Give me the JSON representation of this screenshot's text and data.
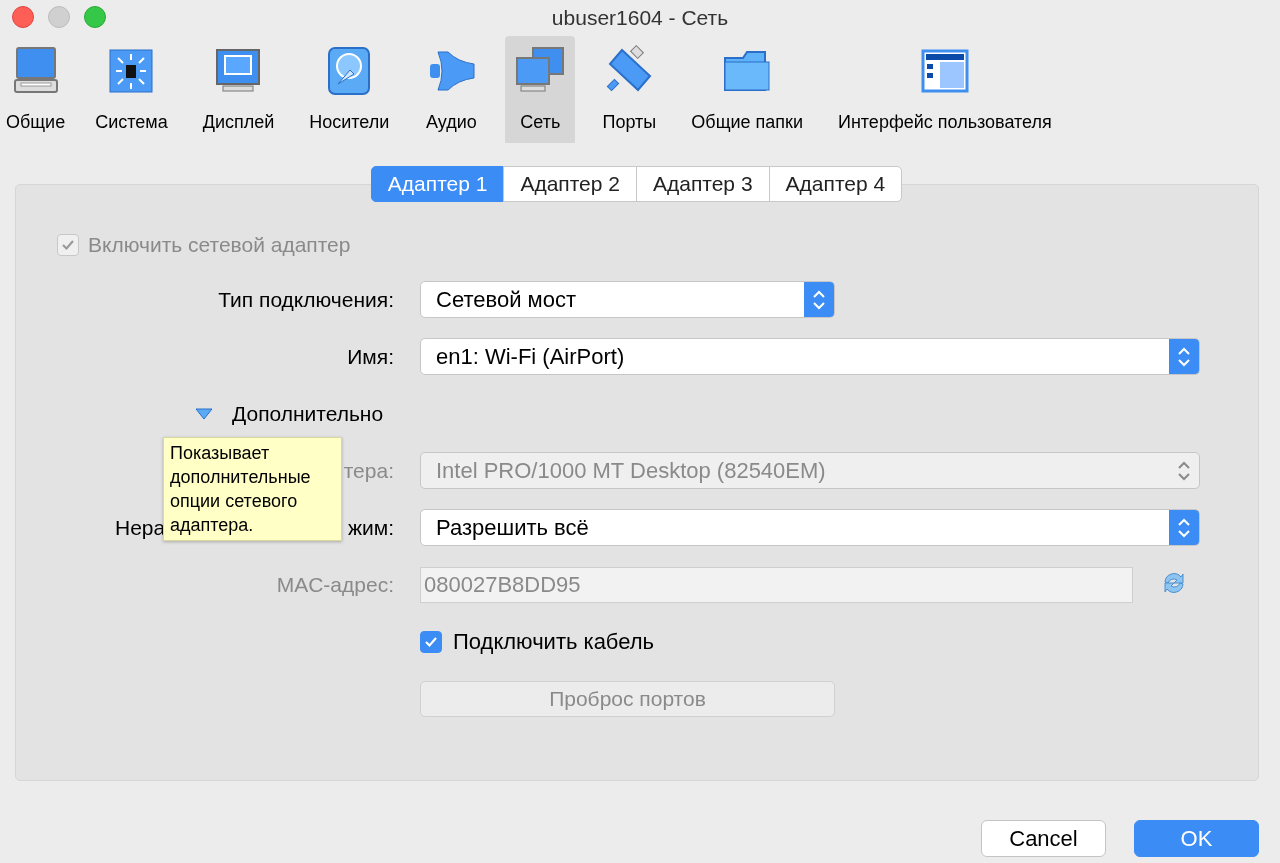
{
  "window": {
    "title": "ubuser1604 - Сеть"
  },
  "toolbar": [
    {
      "label": "Общие",
      "kind": "general",
      "selected": false
    },
    {
      "label": "Система",
      "kind": "system",
      "selected": false
    },
    {
      "label": "Дисплей",
      "kind": "display",
      "selected": false
    },
    {
      "label": "Носители",
      "kind": "storage",
      "selected": false
    },
    {
      "label": "Аудио",
      "kind": "audio",
      "selected": false
    },
    {
      "label": "Сеть",
      "kind": "network",
      "selected": true
    },
    {
      "label": "Порты",
      "kind": "ports",
      "selected": false
    },
    {
      "label": "Общие папки",
      "kind": "folders",
      "selected": false
    },
    {
      "label": "Интерфейс пользователя",
      "kind": "ui",
      "selected": false
    }
  ],
  "tabs": [
    {
      "label": "Адаптер 1",
      "selected": true
    },
    {
      "label": "Адаптер 2",
      "selected": false
    },
    {
      "label": "Адаптер 3",
      "selected": false
    },
    {
      "label": "Адаптер 4",
      "selected": false
    }
  ],
  "enable_adapter": {
    "label": "Включить сетевой адаптер",
    "checked": true,
    "disabled": true
  },
  "rows": [
    {
      "kind": "select",
      "label": "Тип подключения:",
      "value": "Сетевой мост",
      "disabled": false,
      "wide": false
    },
    {
      "kind": "select",
      "label": "Имя:",
      "value": "en1: Wi-Fi (AirPort)",
      "disabled": false,
      "wide": true
    },
    {
      "kind": "disclosure",
      "label": "Дополнительно",
      "expanded": true
    },
    {
      "kind": "select",
      "label": "тера:",
      "value": "Intel PRO/1000 MT Desktop (82540EM)",
      "disabled": true,
      "wide": true
    },
    {
      "kind": "select",
      "label": "Нера",
      "label_end": "жим:",
      "value": "Разрешить всё",
      "disabled": false,
      "wide": true
    },
    {
      "kind": "text",
      "label": "MAC-адрес:",
      "value": "080027B8DD95",
      "disabled": true
    },
    {
      "kind": "checkbox",
      "label": "Подключить кабель",
      "checked": true,
      "disabled": false
    },
    {
      "kind": "button",
      "label": "Проброс портов",
      "disabled": true
    }
  ],
  "tooltip": {
    "text": "Показывает дополнительные опции сетевого адаптера."
  },
  "buttons": [
    {
      "label": "Cancel",
      "default": false
    },
    {
      "label": "OK",
      "default": true
    }
  ]
}
